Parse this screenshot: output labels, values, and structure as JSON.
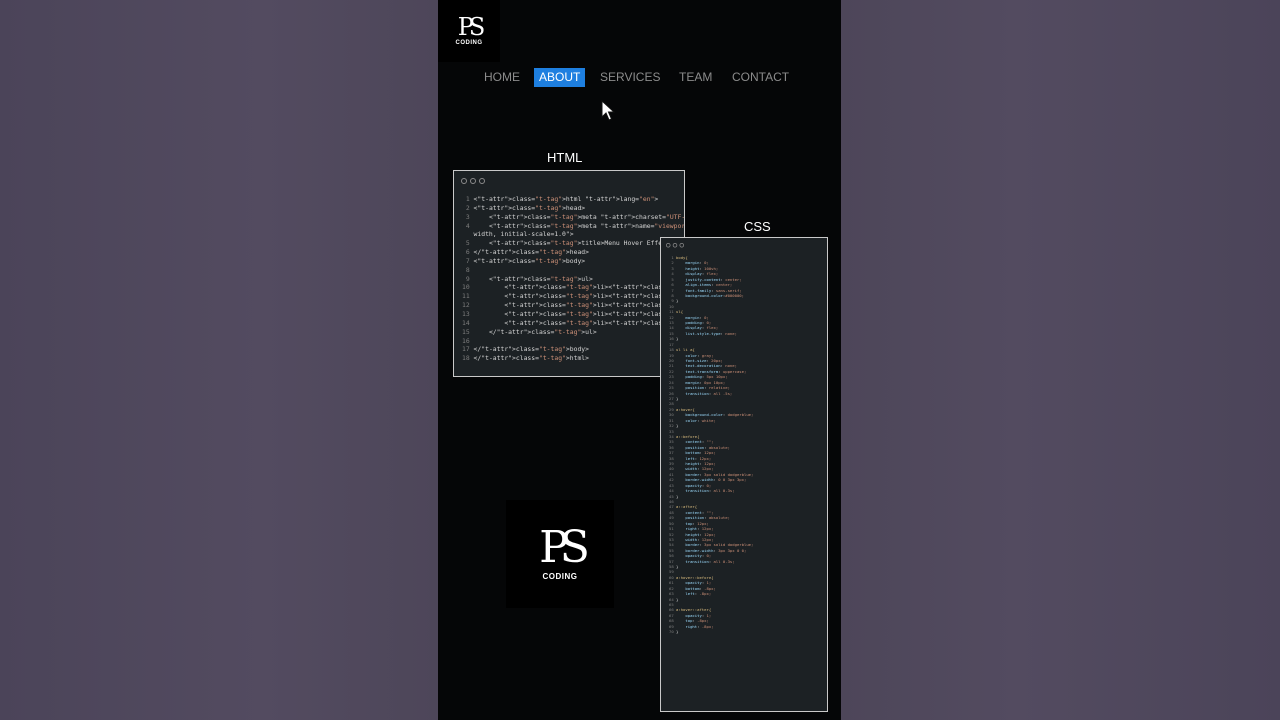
{
  "brand": {
    "mark": "PS",
    "name": "CODING"
  },
  "nav": {
    "items": [
      {
        "label": "home"
      },
      {
        "label": "about"
      },
      {
        "label": "services"
      },
      {
        "label": "team"
      },
      {
        "label": "contact"
      }
    ],
    "active_label": "about",
    "accent": "#1e7fe0"
  },
  "html_panel": {
    "label": "HTML",
    "lines": [
      "<html lang=\"en\">",
      "<head>",
      "    <meta charset=\"UTF-8\">",
      "    <meta name=\"viewport\" content=\"width=device-",
      "width, initial-scale=1.0\">",
      "    <title>Menu Hover Effect</title>",
      "</head>",
      "<body>",
      "",
      "    <ul>",
      "        <li><a href=\"#\">home</a></li>",
      "        <li><a href=\"#\">about</a></li>",
      "        <li><a href=\"#\">services</a></li>",
      "        <li><a href=\"#\">team</a></li>",
      "        <li><a href=\"#\">contact</a></li>",
      "    </ul>",
      "",
      "</body>",
      "</html>"
    ]
  },
  "css_panel": {
    "label": "CSS",
    "lines": [
      "body{",
      "    margin: 0;",
      "    height: 100vh;",
      "    display: flex;",
      "    justify-content: center;",
      "    align-items: center;",
      "    font-family: sans-serif;",
      "    background-color:#000000;",
      "}",
      "",
      "ul{",
      "    margin: 0;",
      "    padding: 0;",
      "    display: flex;",
      "    list-style-type: none;",
      "}",
      "",
      "ul li a{",
      "    color: gray;",
      "    font-size: 20px;",
      "    text-decoration: none;",
      "    text-transform: uppercase;",
      "    padding: 5px 10px;",
      "    margin: 0px 10px;",
      "    position: relative;",
      "    transition: all .5s;",
      "}",
      "",
      "a:hover{",
      "    background-color: dodgerblue;",
      "    color: white;",
      "}",
      "",
      "a::before{",
      "    content: \"\";",
      "    position: absolute;",
      "    bottom: 12px;",
      "    left: 12px;",
      "    height: 12px;",
      "    width: 12px;",
      "    border: 3px solid dodgerblue;",
      "    border-width: 0 0 3px 3px;",
      "    opacity: 0;",
      "    transition: all 0.3s;",
      "}",
      "",
      "a::after{",
      "    content: \"\";",
      "    position: absolute;",
      "    top: 12px;",
      "    right: 12px;",
      "    height: 12px;",
      "    width: 12px;",
      "    border: 3px solid dodgerblue;",
      "    border-width: 3px 3px 0 0;",
      "    opacity: 0;",
      "    transition: all 0.3s;",
      "}",
      "",
      "a:hover::before{",
      "    opacity: 1;",
      "    bottom: -8px;",
      "    left: -8px;",
      "}",
      "",
      "a:hover::after{",
      "    opacity: 1;",
      "    top: -8px;",
      "    right: -8px;",
      "}"
    ]
  }
}
